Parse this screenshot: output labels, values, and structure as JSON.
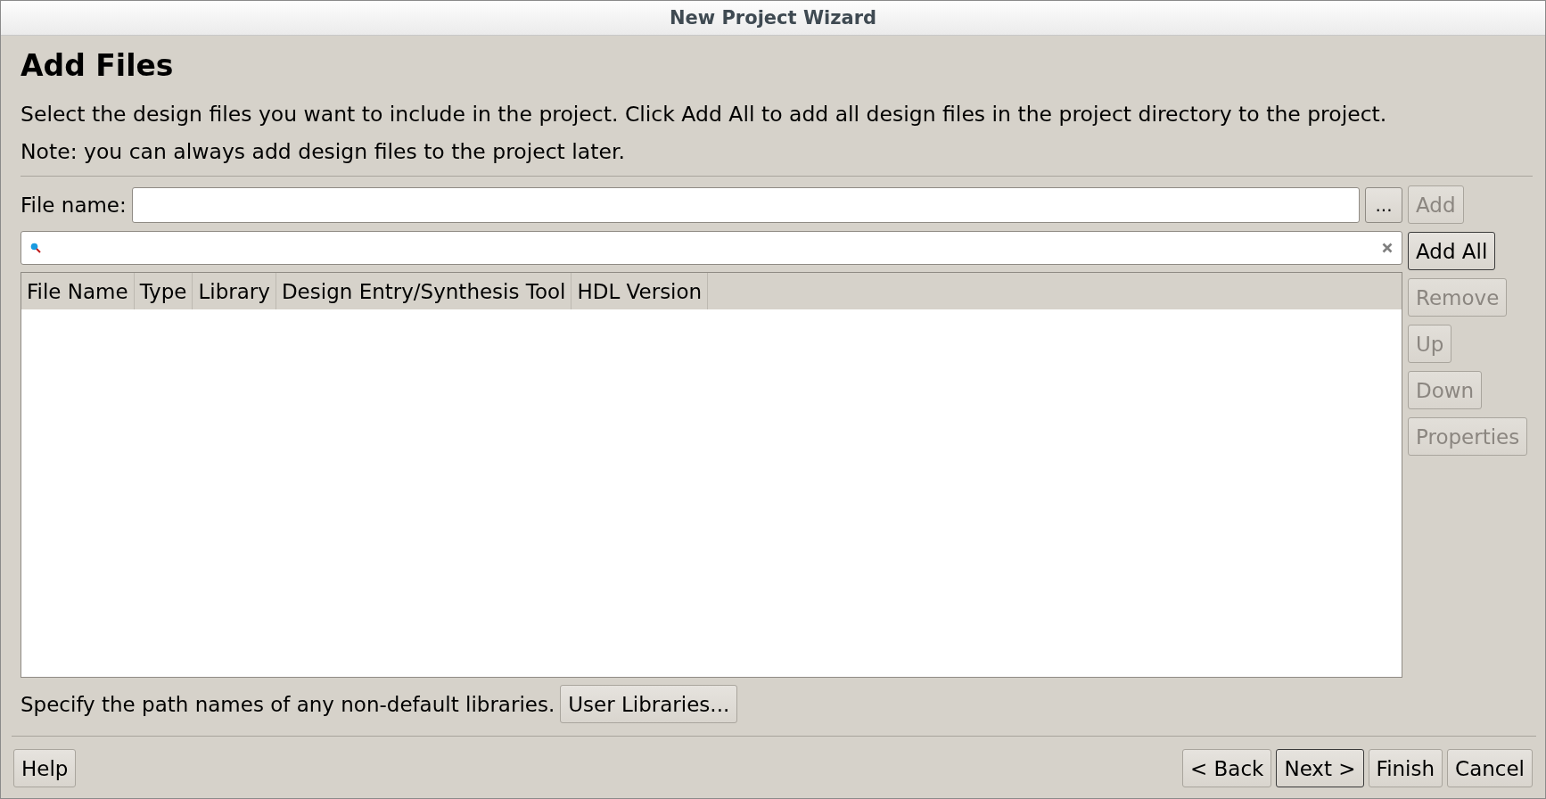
{
  "window": {
    "title": "New Project Wizard"
  },
  "page": {
    "heading": "Add Files",
    "description": "Select the design files you want to include in the project. Click Add All to add all design files in the project directory to the project.",
    "note": "Note: you can always add design files to the project later."
  },
  "file_name": {
    "label": "File name:",
    "browse_button": "..."
  },
  "side_buttons": [
    {
      "label": "Add",
      "disabled": true,
      "default": false
    },
    {
      "label": "Add All",
      "disabled": false,
      "default": true
    },
    {
      "label": "Remove",
      "disabled": true,
      "default": false
    },
    {
      "label": "Up",
      "disabled": true,
      "default": false
    },
    {
      "label": "Down",
      "disabled": true,
      "default": false
    },
    {
      "label": "Properties",
      "disabled": true,
      "default": false
    }
  ],
  "table": {
    "columns": [
      "File Name",
      "Type",
      "Library",
      "Design Entry/Synthesis Tool",
      "HDL Version"
    ]
  },
  "libraries": {
    "text": "Specify the path names of any non-default libraries.",
    "button": {
      "label": "User Libraries...",
      "disabled": false,
      "default": false
    }
  },
  "help_button": {
    "label": "Help",
    "disabled": false,
    "default": false
  },
  "nav_buttons": [
    {
      "label": "< Back",
      "disabled": false,
      "default": false
    },
    {
      "label": "Next >",
      "disabled": false,
      "default": true
    },
    {
      "label": "Finish",
      "disabled": false,
      "default": false
    },
    {
      "label": "Cancel",
      "disabled": false,
      "default": false
    }
  ]
}
